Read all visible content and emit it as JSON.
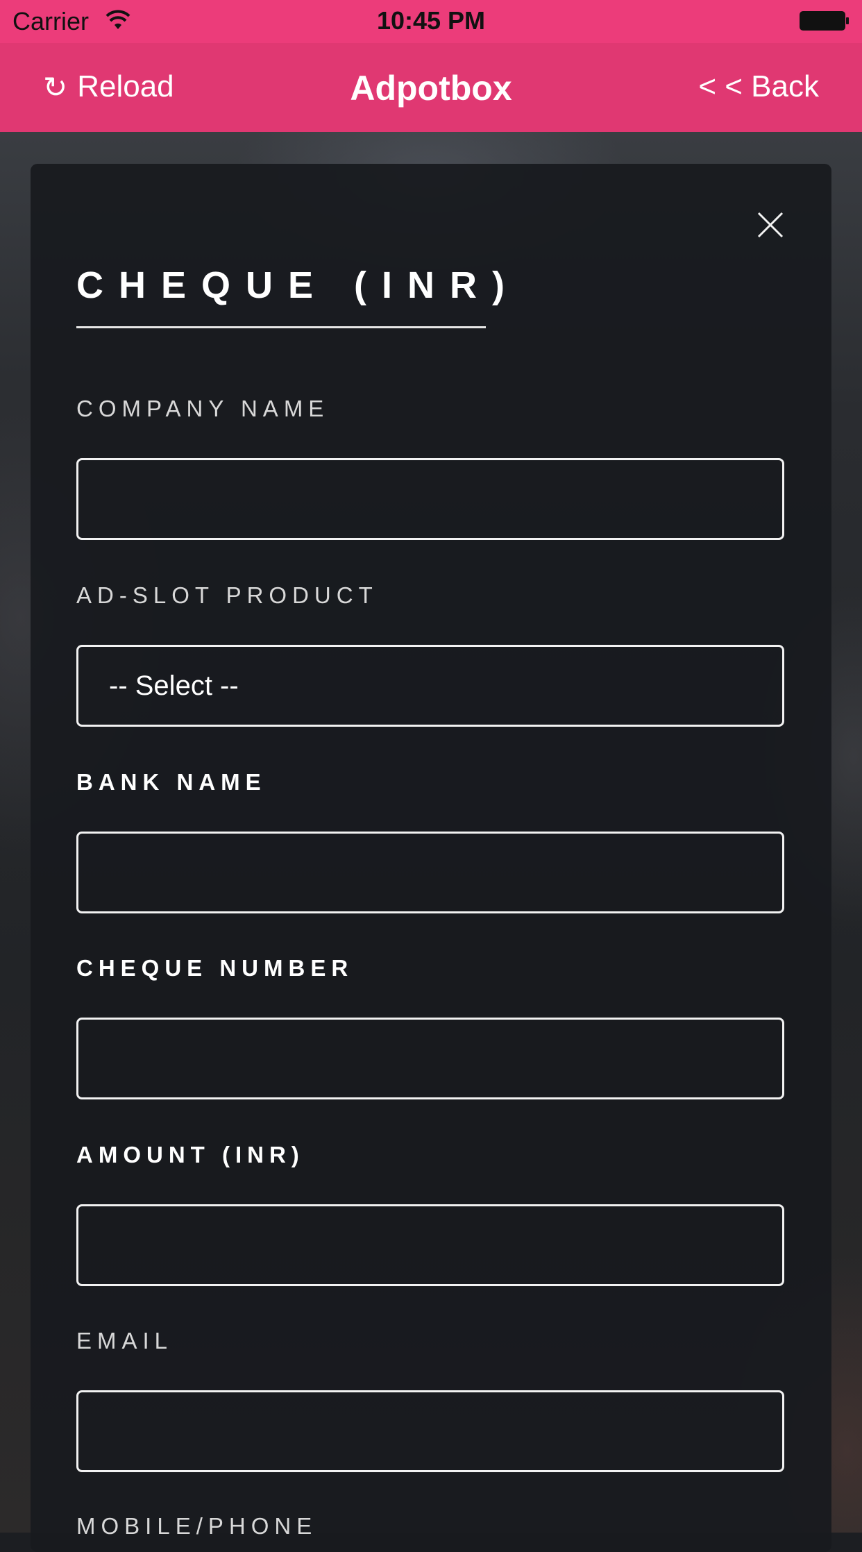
{
  "status_bar": {
    "carrier": "Carrier",
    "time": "10:45 PM",
    "wifi_icon": "wifi-icon",
    "battery_icon": "battery-icon"
  },
  "nav": {
    "reload_label": "Reload",
    "reload_icon": "↻",
    "title": "Adpotbox",
    "back_label": "< < Back"
  },
  "form": {
    "title": "CHEQUE (INR)",
    "close_icon": "close-icon",
    "fields": {
      "company_name": {
        "label": "COMPANY NAME",
        "value": ""
      },
      "ad_slot_product": {
        "label": "AD-SLOT PRODUCT",
        "selected": "-- Select --"
      },
      "bank_name": {
        "label": "BANK NAME",
        "value": ""
      },
      "cheque_number": {
        "label": "CHEQUE NUMBER",
        "value": ""
      },
      "amount": {
        "label": "AMOUNT (INR)",
        "value": ""
      },
      "email": {
        "label": "EMAIL",
        "value": ""
      },
      "mobile": {
        "label": "MOBILE/PHONE"
      }
    }
  },
  "colors": {
    "accent": "#e03872",
    "status_bar": "#ec3c7a",
    "panel": "#181a1e"
  }
}
